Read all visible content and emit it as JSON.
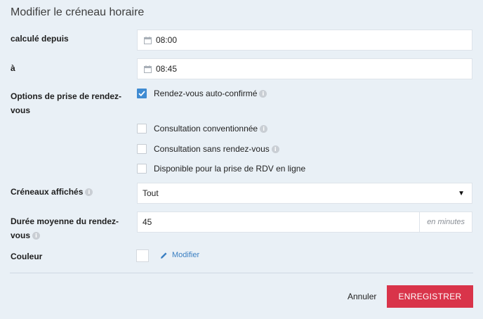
{
  "dialog": {
    "title": "Modifier le créneau horaire"
  },
  "from": {
    "label": "calculé depuis",
    "value": "08:00",
    "icon": "calendar-icon"
  },
  "to": {
    "label": "à",
    "value": "08:45",
    "icon": "calendar-icon"
  },
  "options": {
    "label": "Options de prise de rendez-vous",
    "items": [
      {
        "label": "Rendez-vous auto-confirmé",
        "checked": true,
        "info": true
      },
      {
        "label": "Consultation conventionnée",
        "checked": false,
        "info": true
      },
      {
        "label": "Consultation sans rendez-vous",
        "checked": false,
        "info": true
      },
      {
        "label": "Disponible pour la prise de RDV en ligne",
        "checked": false,
        "info": false
      }
    ]
  },
  "slots": {
    "label": "Créneaux affichés",
    "selected": "Tout"
  },
  "duration": {
    "label": "Durée moyenne du rendez-vous",
    "value": "45",
    "unit": "en minutes"
  },
  "color": {
    "label": "Couleur",
    "edit_label": "Modifier",
    "value": "#ffffff"
  },
  "footer": {
    "cancel_label": "Annuler",
    "save_label": "ENREGISTRER"
  },
  "colors": {
    "accent": "#3f8bd2",
    "primary_button": "#d9344a",
    "link": "#3a7fc2",
    "background": "#e9f0f6"
  }
}
